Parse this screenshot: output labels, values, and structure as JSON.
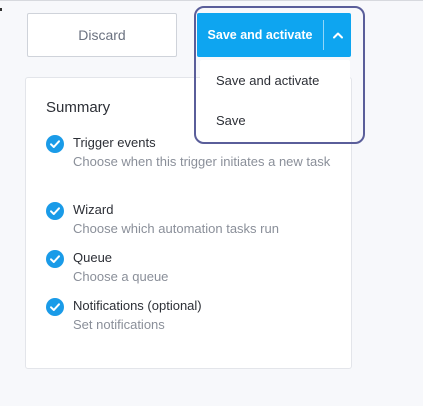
{
  "actions": {
    "discard_label": "Discard",
    "save_label": "Save and activate",
    "chevron_icon": "chevron-up-icon",
    "menu_items": [
      "Save and activate",
      "Save"
    ]
  },
  "summary": {
    "title": "Summary",
    "steps": [
      {
        "title": "Trigger events",
        "description": "Choose when this trigger initiates a new task",
        "status": "complete"
      },
      {
        "title": "Wizard",
        "description": "Choose which automation tasks run",
        "status": "complete"
      },
      {
        "title": "Queue",
        "description": "Choose a queue",
        "status": "complete"
      },
      {
        "title": "Notifications (optional)",
        "description": "Set notifications",
        "status": "complete"
      }
    ]
  },
  "colors": {
    "accent": "#0ea5f0",
    "check": "#1a9be8",
    "focus_ring": "#5a5e9a"
  }
}
